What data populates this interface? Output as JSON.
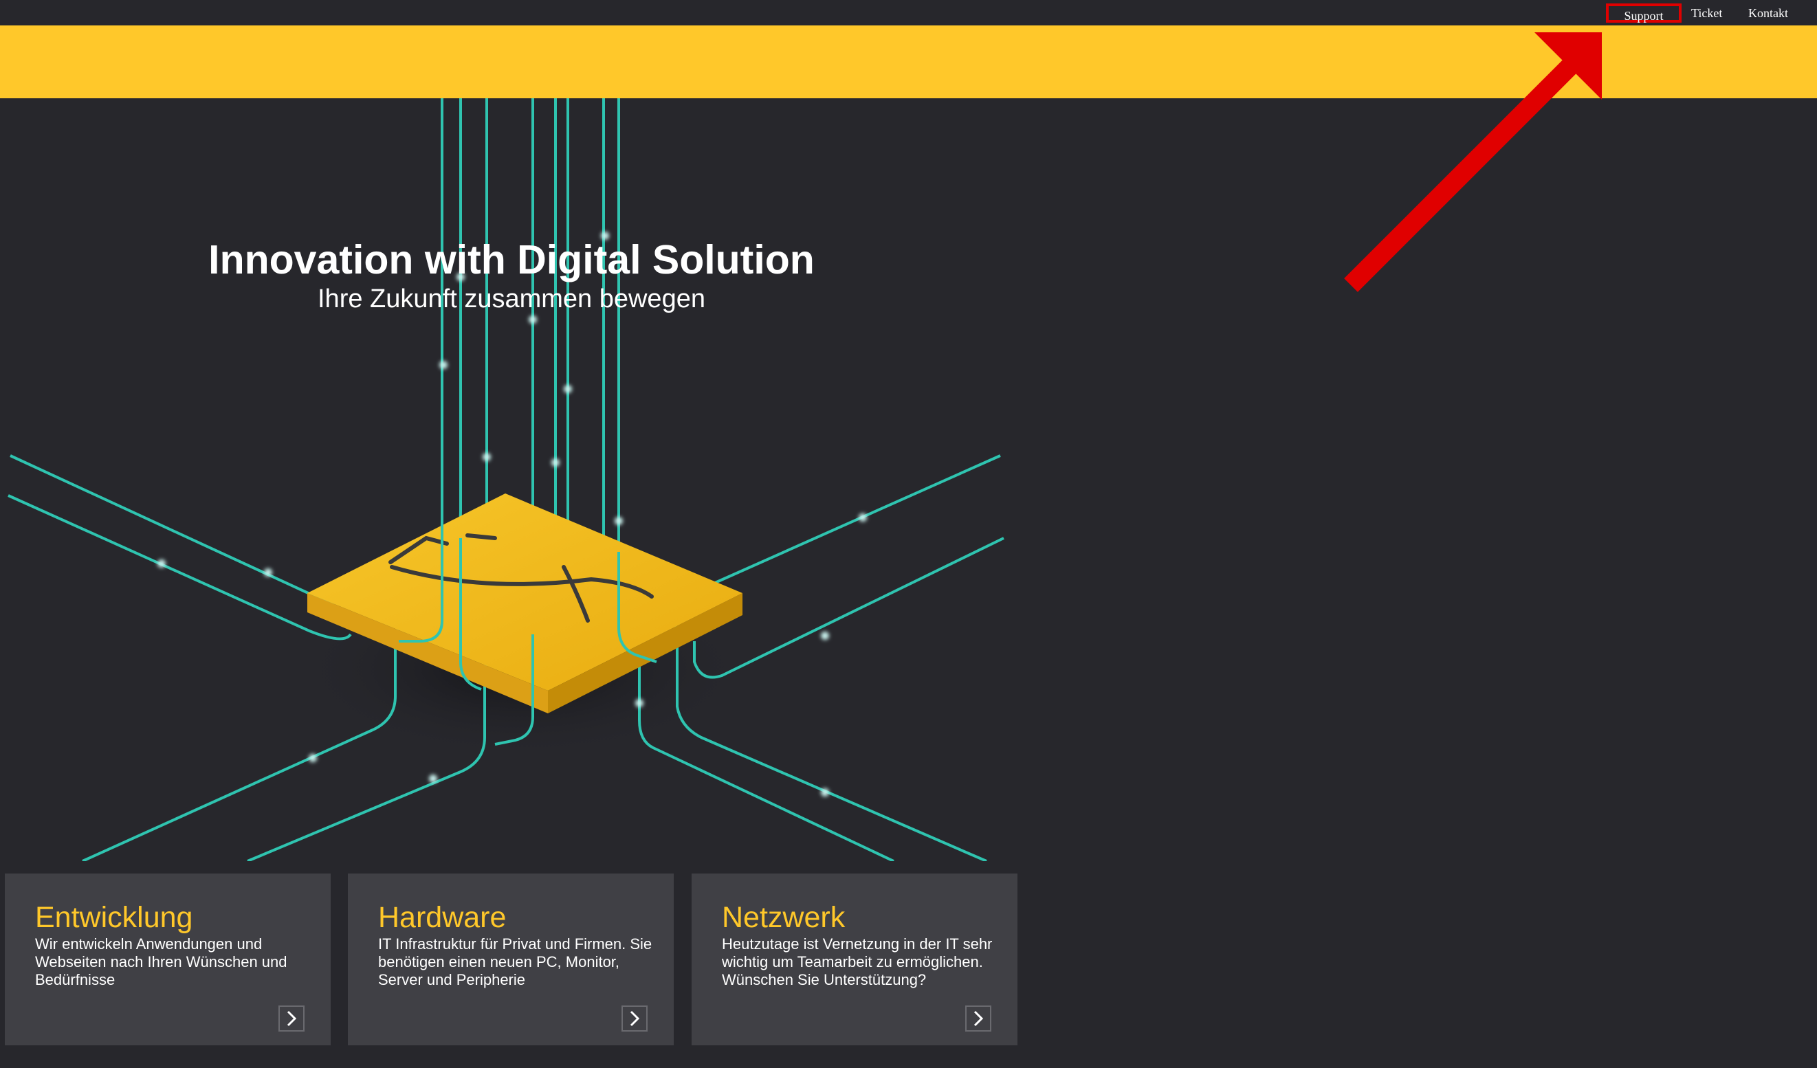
{
  "nav": {
    "support": "Support",
    "ticket": "Ticket",
    "kontakt": "Kontakt"
  },
  "hero": {
    "title": "Innovation with Digital Solution",
    "subtitle": "Ihre Zukunft zusammen bewegen"
  },
  "cards": [
    {
      "title": "Entwicklung",
      "text": "Wir entwickeln Anwendungen und Webseiten nach Ihren Wünschen und Bedürfnisse",
      "icon": "chevron-right-icon"
    },
    {
      "title": "Hardware",
      "text": "IT Infrastruktur für Privat und Firmen. Sie benötigen einen neuen PC, Monitor, Server und Peripherie",
      "icon": "chevron-right-icon"
    },
    {
      "title": "Netzwerk",
      "text": "Heutzutage ist Vernetzung in der IT sehr wichtig um Teamarbeit zu ermöglichen. Wünschen Sie Unterstützung?",
      "icon": "chevron-right-icon"
    }
  ],
  "colors": {
    "background": "#27272c",
    "accent": "#ffc82a",
    "card": "#404045",
    "line": "#2fc4b0",
    "highlight": "#e00000"
  }
}
